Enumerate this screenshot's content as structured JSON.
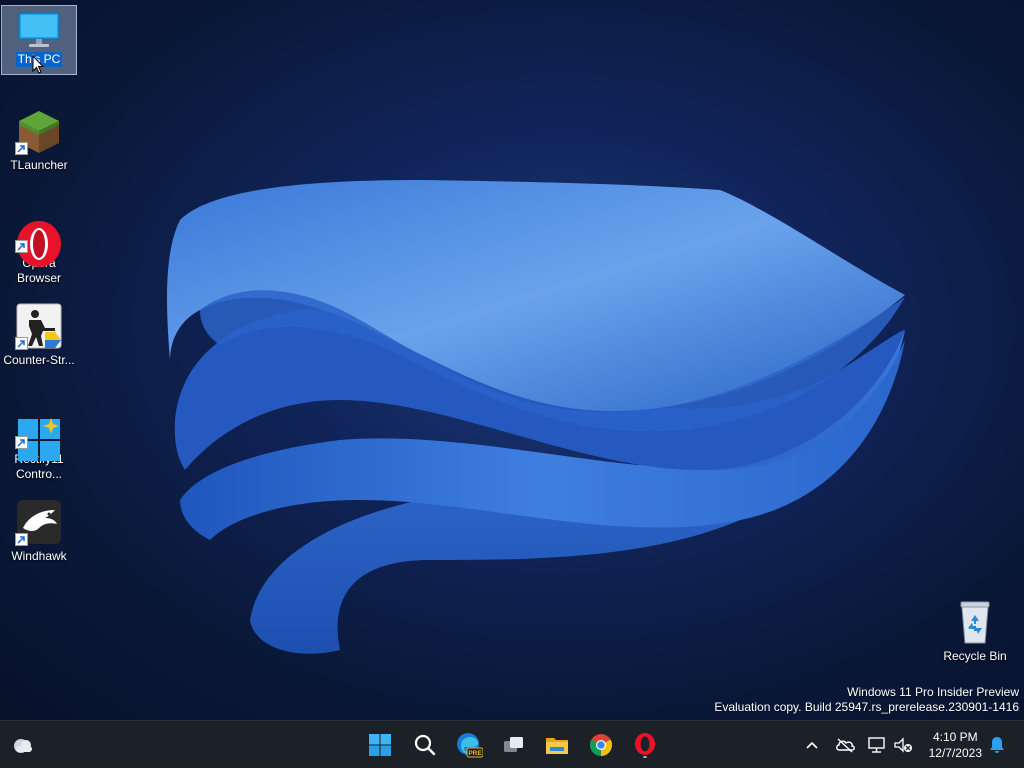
{
  "desktop": {
    "icons": [
      {
        "label": "This PC",
        "name": "this-pc"
      },
      {
        "label": "TLauncher",
        "name": "tlauncher"
      },
      {
        "label": "Opera\nBrowser",
        "name": "opera-browser"
      },
      {
        "label": "Counter-Str...",
        "name": "counter-strike"
      },
      {
        "label": "Rectify11\nContro...",
        "name": "rectify11-control"
      },
      {
        "label": "Windhawk",
        "name": "windhawk"
      },
      {
        "label": "Recycle Bin",
        "name": "recycle-bin"
      }
    ],
    "watermark": {
      "line1": "Windows 11 Pro Insider Preview",
      "line2": "Evaluation copy. Build 25947.rs_prerelease.230901-1416"
    }
  },
  "taskbar": {
    "widgets_icon": "weather-cloud-icon",
    "pinned": [
      {
        "name": "start-button",
        "icon": "windows-logo-icon"
      },
      {
        "name": "search-button",
        "icon": "search-icon"
      },
      {
        "name": "edge-button",
        "icon": "edge-pre-icon",
        "badge": "PRE"
      },
      {
        "name": "task-view-button",
        "icon": "task-view-icon"
      },
      {
        "name": "file-explorer-button",
        "icon": "folder-icon"
      },
      {
        "name": "chrome-button",
        "icon": "chrome-icon"
      },
      {
        "name": "opera-button",
        "icon": "opera-icon"
      }
    ],
    "tray": {
      "time": "4:10 PM",
      "date": "12/7/2023"
    }
  },
  "colors": {
    "accent": "#0a64c8",
    "taskbar_bg": "#1c2027",
    "wallpaper_dark": "#07112a",
    "wallpaper_blue": "#2f6fd6"
  }
}
